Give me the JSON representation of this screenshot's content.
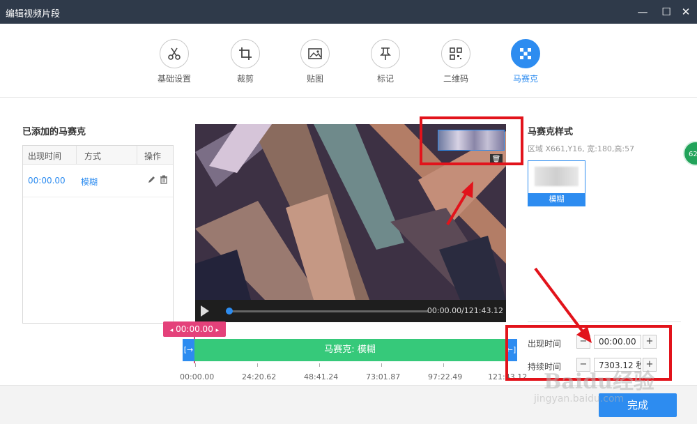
{
  "window": {
    "title": "编辑视频片段",
    "minimize": "—",
    "maximize": "☐",
    "close": "✕"
  },
  "toolbar": {
    "tools": [
      {
        "label": "基础设置",
        "icon": "scissors-icon"
      },
      {
        "label": "裁剪",
        "icon": "crop-icon"
      },
      {
        "label": "贴图",
        "icon": "image-icon"
      },
      {
        "label": "标记",
        "icon": "pin-icon"
      },
      {
        "label": "二维码",
        "icon": "qrcode-icon"
      },
      {
        "label": "马赛克",
        "icon": "mosaic-icon",
        "active": true
      }
    ]
  },
  "left_panel": {
    "title": "已添加的马赛克",
    "headers": [
      "出现时间",
      "方式",
      "操作"
    ],
    "rows": [
      {
        "time": "00:00.00",
        "mode": "模糊",
        "actions": [
          "edit-icon",
          "trash-icon"
        ]
      }
    ]
  },
  "player": {
    "time_readout": "00:00.00/121:43.12",
    "progress": 0.0
  },
  "timeline": {
    "marker": "00:00.00",
    "clip_label": "马赛克: 模糊",
    "ticks": [
      "00:00.00",
      "24:20.62",
      "48:41.24",
      "73:01.87",
      "97:22.49",
      "121:43.12"
    ]
  },
  "right_panel": {
    "title": "马赛克样式",
    "region": "区域 X661,Y16, 宽:180,高:57",
    "style_label": "模糊",
    "appear_label": "出现时间",
    "appear_value": "00:00.00",
    "duration_label": "持续时间",
    "duration_value": "7303.12 秒",
    "minus": "−",
    "plus": "+"
  },
  "footer": {
    "done": "完成"
  },
  "side_badge": "62",
  "watermark": {
    "line1": "Baidu经验",
    "line2": "jingyan.baidu.com"
  },
  "colors": {
    "accent": "#2d8cf0",
    "titlebar": "#2f3a4a",
    "clip": "#36c97a",
    "marker": "#e4417a",
    "annotation": "#e2131b"
  }
}
